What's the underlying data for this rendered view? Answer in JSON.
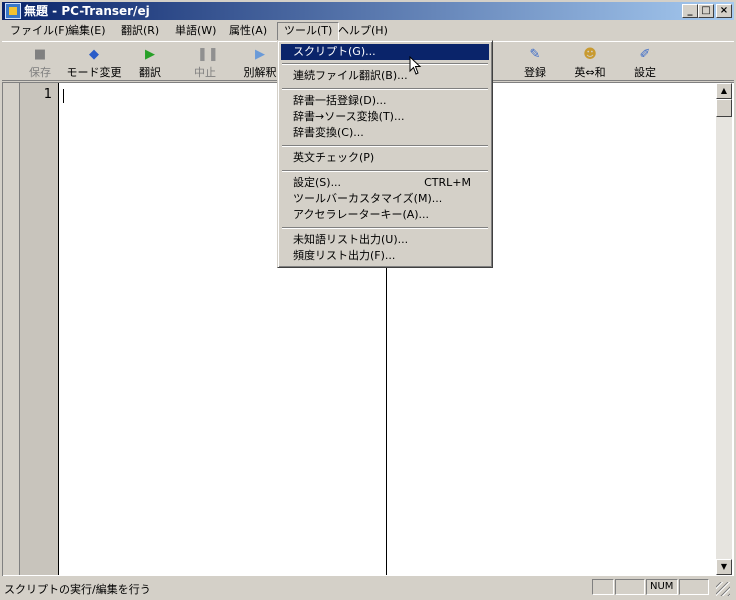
{
  "window": {
    "title": "無題 - PC-Transer/ej"
  },
  "menubar": [
    "ファイル(F)",
    "編集(E)",
    "翻訳(R)",
    "単語(W)",
    "属性(A)",
    "ツール(T)",
    "ヘルプ(H)"
  ],
  "toolbar": {
    "save": "保存",
    "mode": "モード変更",
    "translate": "翻訳",
    "stop": "中止",
    "alt": "別解釈",
    "register": "登録",
    "ej": "英⇔和",
    "settings": "設定"
  },
  "editor": {
    "line_number": "1"
  },
  "dropdown": {
    "items": [
      {
        "label": "スクリプト(G)...",
        "shortcut": ""
      },
      {
        "label": "連続ファイル翻訳(B)...",
        "shortcut": ""
      },
      {
        "label": "辞書一括登録(D)...",
        "shortcut": ""
      },
      {
        "label": "辞書→ソース変換(T)...",
        "shortcut": ""
      },
      {
        "label": "辞書変換(C)...",
        "shortcut": ""
      },
      {
        "label": "英文チェック(P)",
        "shortcut": ""
      },
      {
        "label": "設定(S)...",
        "shortcut": "CTRL+M"
      },
      {
        "label": "ツールバーカスタマイズ(M)...",
        "shortcut": ""
      },
      {
        "label": "アクセラレーターキー(A)...",
        "shortcut": ""
      },
      {
        "label": "未知語リスト出力(U)...",
        "shortcut": ""
      },
      {
        "label": "頻度リスト出力(F)...",
        "shortcut": ""
      }
    ]
  },
  "statusbar": {
    "text": "スクリプトの実行/編集を行う",
    "num": "NUM"
  }
}
